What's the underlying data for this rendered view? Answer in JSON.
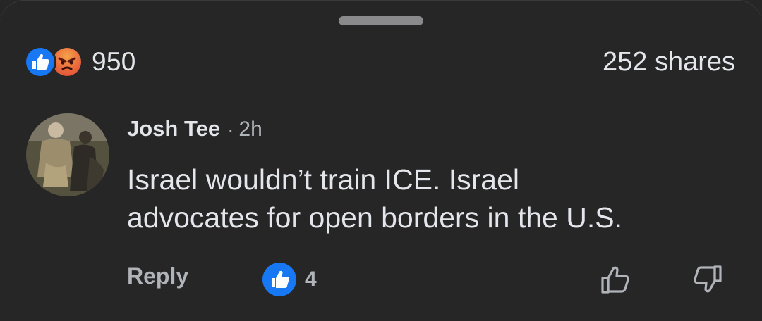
{
  "reactions": {
    "icons": [
      "like-icon",
      "angry-icon"
    ],
    "count": "950"
  },
  "shares": "252 shares",
  "comment": {
    "author": "Josh Tee",
    "separator": "·",
    "time": "2h",
    "text_lines": [
      "Israel wouldn’t train ICE. Israel",
      "advocates for open borders in the U.S."
    ],
    "reply_label": "Reply",
    "like_count": "4"
  },
  "colors": {
    "background": "#262627",
    "text_primary": "#e4e6eb",
    "text_secondary": "#b0b3b8",
    "like_blue": "#1877f2",
    "angry_orange": "#ea6a3c"
  }
}
